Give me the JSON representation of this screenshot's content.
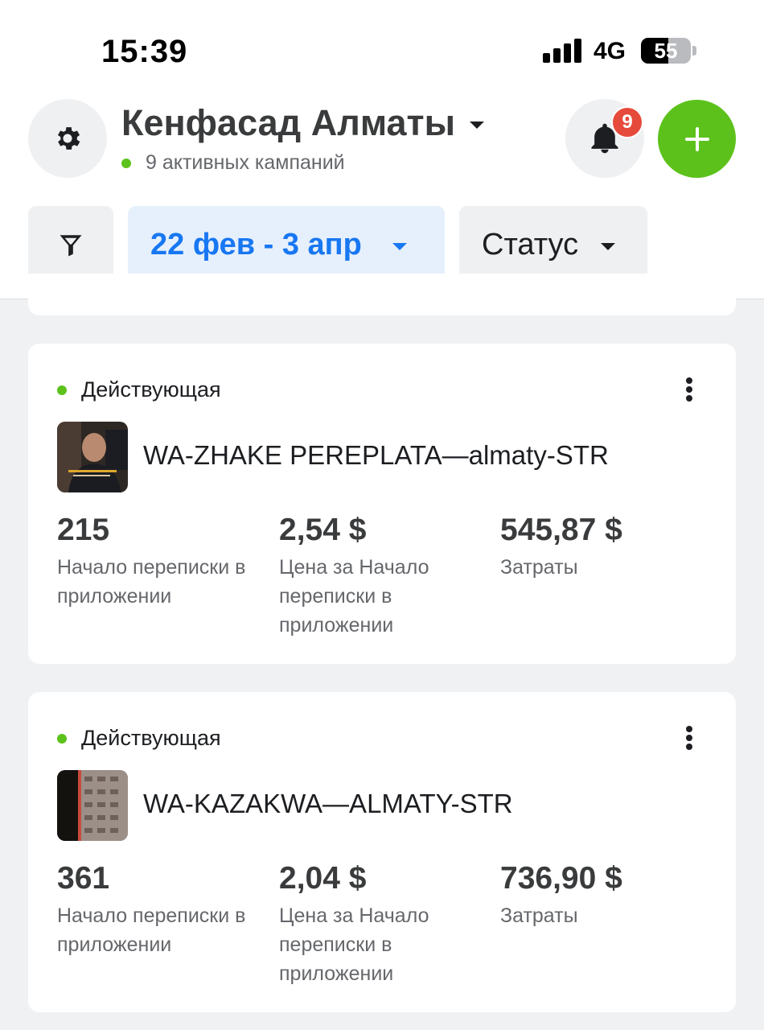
{
  "status_bar": {
    "time": "15:39",
    "network": "4G",
    "battery": "55",
    "battery_level": 0.55
  },
  "header": {
    "account_name": "Кенфасад Алматы",
    "subtitle": "9 активных кампаний",
    "notification_count": "9",
    "icons": {
      "settings": "gear-icon",
      "notifications": "bell-icon",
      "add": "plus-icon",
      "menu": "caret-down-icon"
    }
  },
  "filters": {
    "filter_icon": "funnel-icon",
    "date_range": "22 фев - 3 апр",
    "status": "Статус"
  },
  "campaigns": [
    {
      "status": "Действующая",
      "name": "WA-ZHAKE PEREPLATA—almaty-STR",
      "metrics": [
        {
          "value": "215",
          "label": "Начало переписки в приложении"
        },
        {
          "value": "2,54 $",
          "label": "Цена за Начало переписки в приложении"
        },
        {
          "value": "545,87 $",
          "label": "Затраты"
        }
      ]
    },
    {
      "status": "Действующая",
      "name": "WA-KAZAKWA—ALMATY-STR",
      "metrics": [
        {
          "value": "361",
          "label": "Начало переписки в приложении"
        },
        {
          "value": "2,04 $",
          "label": "Цена за Начало переписки в приложении"
        },
        {
          "value": "736,90 $",
          "label": "Затраты"
        }
      ]
    }
  ],
  "colors": {
    "accent": "#1877f2",
    "active": "#5cc21b",
    "badge": "#e64a3b"
  }
}
